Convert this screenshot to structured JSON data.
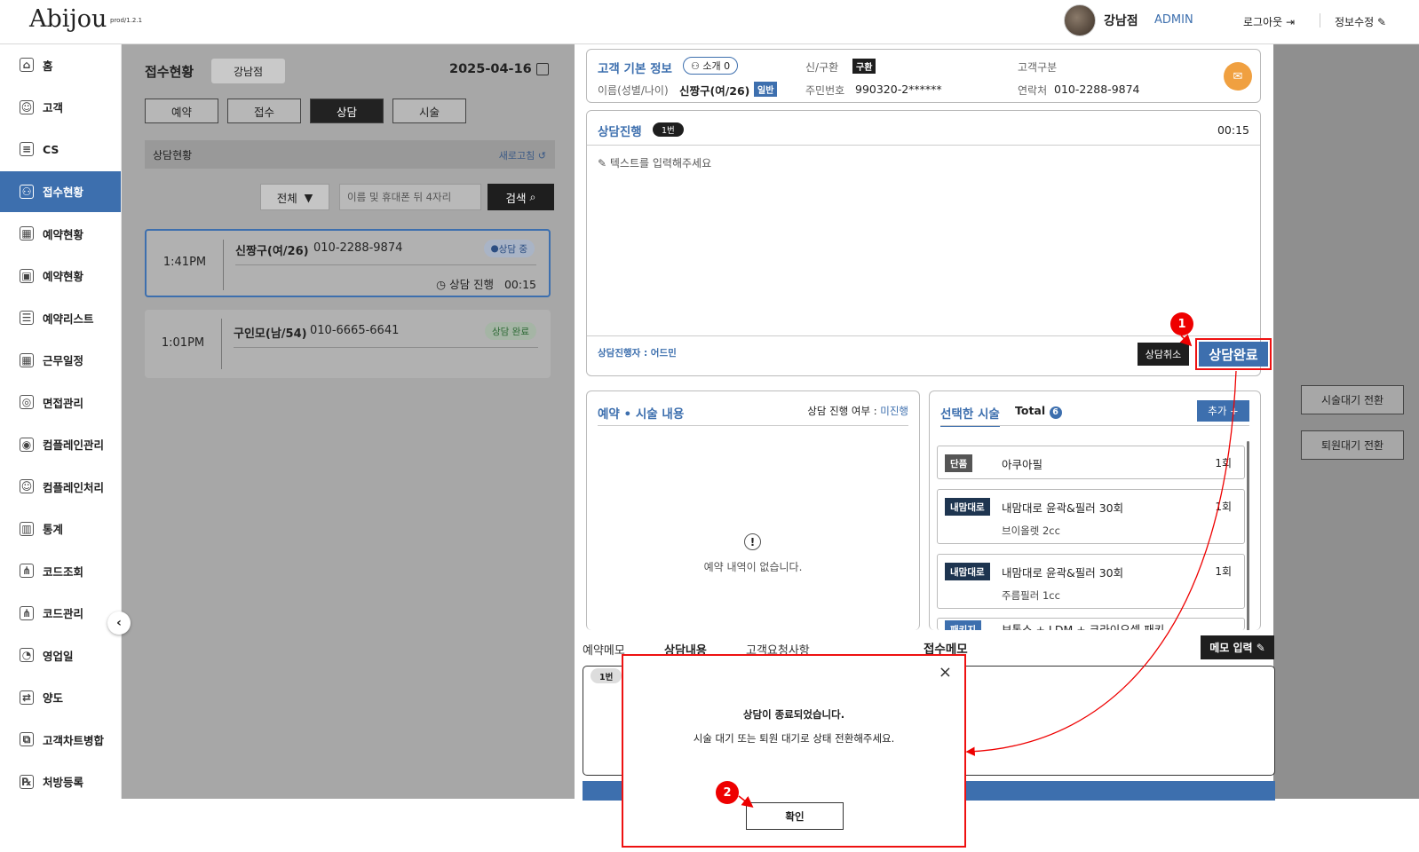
{
  "app": {
    "logo": "Abijou",
    "version": "prod/1.2.1",
    "branch": "강남점",
    "role": "ADMIN",
    "logout": "로그아웃",
    "edit_profile": "정보수정"
  },
  "sidebar": {
    "items": [
      {
        "label": "홈",
        "icon": "home-icon"
      },
      {
        "label": "고객",
        "icon": "users-icon"
      },
      {
        "label": "CS",
        "icon": "cs-icon"
      },
      {
        "label": "접수현황",
        "icon": "reception-icon"
      },
      {
        "label": "예약현황",
        "icon": "calendar-icon"
      },
      {
        "label": "예약현황",
        "icon": "calendar-lock-icon"
      },
      {
        "label": "예약리스트",
        "icon": "list-icon"
      },
      {
        "label": "근무일정",
        "icon": "schedule-icon"
      },
      {
        "label": "면접관리",
        "icon": "interview-icon"
      },
      {
        "label": "컴플레인관리",
        "icon": "complaint-icon"
      },
      {
        "label": "컴플레인처리",
        "icon": "smile-icon"
      },
      {
        "label": "통계",
        "icon": "chart-icon"
      },
      {
        "label": "코드조회",
        "icon": "tree-icon"
      },
      {
        "label": "코드관리",
        "icon": "tree-gear-icon"
      },
      {
        "label": "영업일",
        "icon": "business-day-icon"
      },
      {
        "label": "양도",
        "icon": "transfer-icon"
      },
      {
        "label": "고객차트병합",
        "icon": "merge-icon"
      },
      {
        "label": "처방등록",
        "icon": "prescription-icon"
      }
    ]
  },
  "reception": {
    "title": "접수현황",
    "branch": "강남점",
    "date": "2025-04-16",
    "tabs": [
      "예약",
      "접수",
      "상담",
      "시술"
    ],
    "status_title": "상담현황",
    "refresh": "새로고침",
    "filter": "전체",
    "search_placeholder": "이름 및 휴대폰 뒤 4자리",
    "search_btn": "검색",
    "cards": [
      {
        "time": "1:41PM",
        "name": "신짱구(여/26)",
        "phone": "010-2288-9874",
        "badge": "상담 중",
        "progress_label": "상담 진행",
        "progress_time": "00:15"
      },
      {
        "time": "1:01PM",
        "name": "구인모(남/54)",
        "phone": "010-6665-6641",
        "badge": "상담 완료"
      }
    ]
  },
  "customer": {
    "section": "고객 기본 정보",
    "referral": "소개 0",
    "name_label": "이름(성별/나이)",
    "name": "신짱구(여/26)",
    "grade": "일반",
    "newold_label": "신/구환",
    "newold": "구환",
    "id_label": "주민번호",
    "id": "990320-2******",
    "type_label": "고객구분",
    "phone_label": "연락처",
    "phone": "010-2288-9874"
  },
  "consult": {
    "title": "상담진행",
    "num": "1번",
    "timer": "00:15",
    "placeholder": "텍스트를 입력해주세요",
    "staff": "상담진행자 : 어드민",
    "cancel": "상담취소",
    "complete": "상담완료"
  },
  "reservation": {
    "title": "예약 • 시술 내용",
    "status_label": "상담 진행 여부 :",
    "status": "미진행",
    "empty": "예약 내역이 없습니다."
  },
  "treatments": {
    "title": "선택한 시술",
    "total_label": "Total",
    "total": "6",
    "add": "추가",
    "items": [
      {
        "kind": "단품",
        "name": "아쿠아필",
        "count": "1회",
        "sub": ""
      },
      {
        "kind": "내맘대로",
        "name": "내맘대로 윤곽&필러 30회",
        "count": "1회",
        "sub": "브이올렛 2cc"
      },
      {
        "kind": "내맘대로",
        "name": "내맘대로 윤곽&필러 30회",
        "count": "1회",
        "sub": "주름필러 1cc"
      },
      {
        "kind": "패키지",
        "name": "보톡스 + LDM + 크라이오셀 패키...",
        "count": "",
        "sub": ""
      }
    ]
  },
  "memo": {
    "tabs": [
      "예약메모",
      "상담내용",
      "고객요청사항"
    ],
    "reception_memo": "접수메모",
    "input_btn": "메모 입력",
    "num": "1번"
  },
  "right_buttons": [
    "시술대기 전환",
    "퇴원대기 전환"
  ],
  "dialog": {
    "title": "상담이 종료되었습니다.",
    "message": "시술 대기 또는 퇴원 대기로 상태 전환해주세요.",
    "confirm": "확인"
  },
  "annotations": [
    "1",
    "2"
  ],
  "colors": {
    "primary": "#3d6fae",
    "annotation": "#e00000",
    "dark": "#1e1e1e"
  }
}
